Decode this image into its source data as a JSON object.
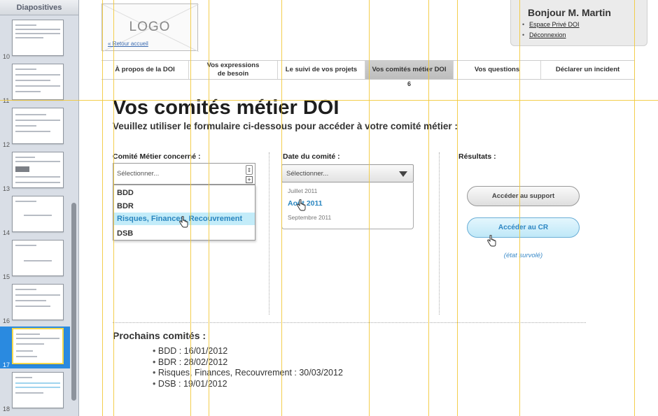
{
  "sidebar": {
    "title": "Diapositives",
    "slides": [
      {
        "num": "10"
      },
      {
        "num": "11"
      },
      {
        "num": "12"
      },
      {
        "num": "13"
      },
      {
        "num": "14"
      },
      {
        "num": "15"
      },
      {
        "num": "16"
      },
      {
        "num": "17",
        "selected": true
      },
      {
        "num": "18"
      }
    ]
  },
  "header": {
    "logo": "LOGO",
    "back_link": "« Retour accueil",
    "greeting": "Bonjour M. Martin",
    "links": [
      "Espace Privé DOI",
      "Déconnexion"
    ]
  },
  "nav": {
    "tabs": [
      {
        "label": "À propos de la DOI"
      },
      {
        "label": "Vos expressions de besoin"
      },
      {
        "label": "Le suivi de vos projets"
      },
      {
        "label": "Vos comités métier DOI",
        "active": true
      },
      {
        "label": "Vos questions"
      },
      {
        "label": "Déclarer un incident"
      }
    ],
    "active_badge": "6"
  },
  "page": {
    "title": "Vos comités métier DOI",
    "subtitle": "Veuillez utiliser le formulaire ci-dessous pour accéder à votre comité métier :"
  },
  "committee": {
    "label": "Comité Métier concerné :",
    "placeholder": "Sélectionner...",
    "options": [
      "BDD",
      "BDR",
      "Risques, Finances, Recouvrement",
      "DSB"
    ],
    "highlighted": "Risques, Finances, Recouvrement"
  },
  "date": {
    "label": "Date du comité :",
    "placeholder": "Sélectionner...",
    "options": [
      "Juillet 2011",
      "Août 2011",
      "Septembre 2011"
    ],
    "highlighted": "Août 2011"
  },
  "results": {
    "label": "Résultats :",
    "support_button": "Accéder au support",
    "cr_button": "Accéder au CR",
    "hover_note": "(état survolé)"
  },
  "upcoming": {
    "title": "Prochains comités :",
    "items": [
      "BDD : 16/01/2012",
      "BDR : 28/02/2012",
      "Risques, Finances, Recouvrement : 30/03/2012",
      "DSB : 19/01/2012"
    ]
  },
  "colors": {
    "accent": "#2a86c0",
    "highlight_bg": "#c3ecf9",
    "guide": "#f2c93a",
    "selection": "#2a8ae0"
  }
}
